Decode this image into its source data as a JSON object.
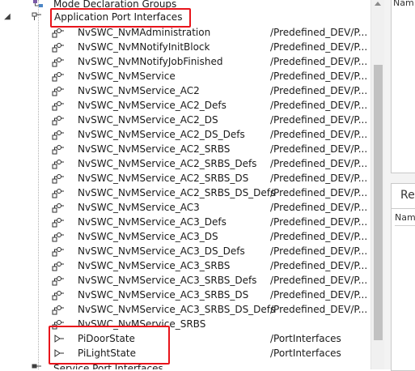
{
  "tree": {
    "top_partial": {
      "label": "Mode Declaration Groups",
      "icon": "mode-declaration-icon"
    },
    "group": {
      "label": "Application Port Interfaces",
      "icon": "folder-tree-icon",
      "expanded": true
    },
    "items": [
      {
        "label": "NvSWC_NvMAdministration",
        "path": "/Predefined_DEV/P...",
        "icon": "client-server-interface-icon"
      },
      {
        "label": "NvSWC_NvMNotifyInitBlock",
        "path": "/Predefined_DEV/P...",
        "icon": "client-server-interface-icon"
      },
      {
        "label": "NvSWC_NvMNotifyJobFinished",
        "path": "/Predefined_DEV/P...",
        "icon": "client-server-interface-icon"
      },
      {
        "label": "NvSWC_NvMService",
        "path": "/Predefined_DEV/P...",
        "icon": "client-server-interface-icon"
      },
      {
        "label": "NvSWC_NvMService_AC2",
        "path": "/Predefined_DEV/P...",
        "icon": "client-server-interface-icon"
      },
      {
        "label": "NvSWC_NvMService_AC2_Defs",
        "path": "/Predefined_DEV/P...",
        "icon": "client-server-interface-icon"
      },
      {
        "label": "NvSWC_NvMService_AC2_DS",
        "path": "/Predefined_DEV/P...",
        "icon": "client-server-interface-icon"
      },
      {
        "label": "NvSWC_NvMService_AC2_DS_Defs",
        "path": "/Predefined_DEV/P...",
        "icon": "client-server-interface-icon"
      },
      {
        "label": "NvSWC_NvMService_AC2_SRBS",
        "path": "/Predefined_DEV/P...",
        "icon": "client-server-interface-icon"
      },
      {
        "label": "NvSWC_NvMService_AC2_SRBS_Defs",
        "path": "/Predefined_DEV/P...",
        "icon": "client-server-interface-icon"
      },
      {
        "label": "NvSWC_NvMService_AC2_SRBS_DS",
        "path": "/Predefined_DEV/P...",
        "icon": "client-server-interface-icon"
      },
      {
        "label": "NvSWC_NvMService_AC2_SRBS_DS_Defs",
        "path": "/Predefined_DEV/P...",
        "icon": "client-server-interface-icon"
      },
      {
        "label": "NvSWC_NvMService_AC3",
        "path": "/Predefined_DEV/P...",
        "icon": "client-server-interface-icon"
      },
      {
        "label": "NvSWC_NvMService_AC3_Defs",
        "path": "/Predefined_DEV/P...",
        "icon": "client-server-interface-icon"
      },
      {
        "label": "NvSWC_NvMService_AC3_DS",
        "path": "/Predefined_DEV/P...",
        "icon": "client-server-interface-icon"
      },
      {
        "label": "NvSWC_NvMService_AC3_DS_Defs",
        "path": "/Predefined_DEV/P...",
        "icon": "client-server-interface-icon"
      },
      {
        "label": "NvSWC_NvMService_AC3_SRBS",
        "path": "/Predefined_DEV/P...",
        "icon": "client-server-interface-icon"
      },
      {
        "label": "NvSWC_NvMService_AC3_SRBS_Defs",
        "path": "/Predefined_DEV/P...",
        "icon": "client-server-interface-icon"
      },
      {
        "label": "NvSWC_NvMService_AC3_SRBS_DS",
        "path": "/Predefined_DEV/P...",
        "icon": "client-server-interface-icon"
      },
      {
        "label": "NvSWC_NvMService_AC3_SRBS_DS_Defs",
        "path": "/Predefined_DEV/P...",
        "icon": "client-server-interface-icon"
      },
      {
        "label": "NvSWC_NvMService_SRBS",
        "path": "",
        "icon": "client-server-interface-icon"
      },
      {
        "label": "PiDoorState",
        "path": "/PortInterfaces",
        "icon": "sender-receiver-interface-icon"
      },
      {
        "label": "PiLightState",
        "path": "/PortInterfaces",
        "icon": "sender-receiver-interface-icon"
      }
    ],
    "bottom_partial": {
      "label": "Service Port Interfaces",
      "icon": "folder-tree-icon"
    }
  },
  "right_pane": {
    "panel1_header": "Nam",
    "panel2_tab": "Re",
    "panel2_header": "Nam"
  },
  "colors": {
    "highlight": "#e8141b",
    "scroll_thumb": "#c1c1c1",
    "scroll_track": "#f0f0f0"
  }
}
